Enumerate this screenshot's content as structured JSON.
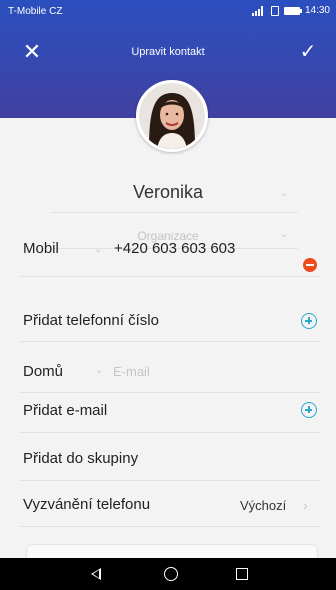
{
  "status_bar": {
    "carrier": "T-Mobile CZ",
    "time": "14:30"
  },
  "header": {
    "title": "Upravit kontakt",
    "close_icon": "close-icon",
    "confirm_icon": "check-icon"
  },
  "contact": {
    "name": "Veronika",
    "organization_placeholder": "Organizace"
  },
  "phone": {
    "type_label": "Mobil",
    "value": "+420 603 603 603",
    "remove_icon": "remove-icon",
    "add_label": "Přidat telefonní číslo",
    "add_icon": "add-icon"
  },
  "email": {
    "type_label": "Domů",
    "placeholder": "E-mail",
    "add_label": "Přidat e-mail",
    "add_icon": "add-icon"
  },
  "group": {
    "add_label": "Přidat do skupiny"
  },
  "ringtone": {
    "label": "Vyzvánění telefonu",
    "value": "Výchozí"
  },
  "colors": {
    "header_top": "#2b4fbe",
    "header_bottom": "#41409f",
    "remove_red": "#ee4b1f",
    "add_blue": "#27a9c9"
  }
}
